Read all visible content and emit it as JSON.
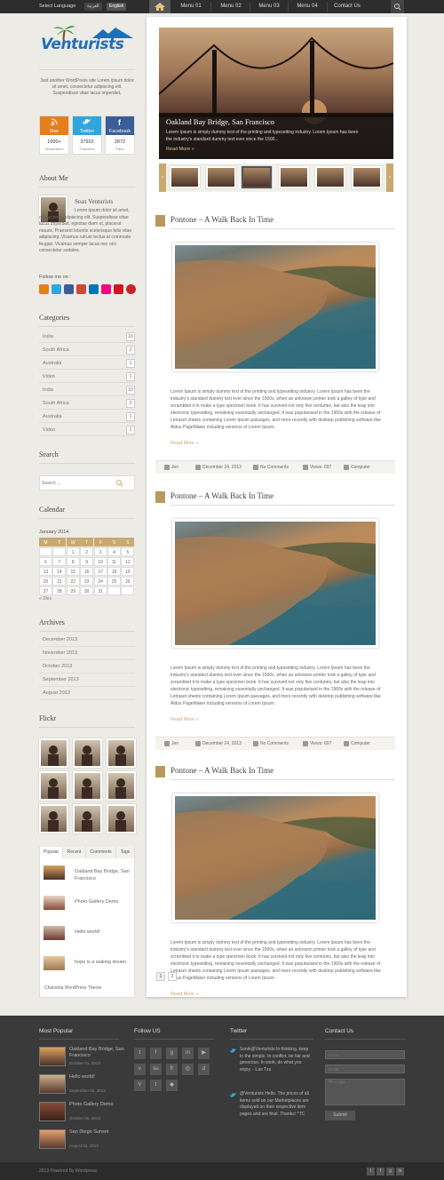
{
  "topbar": {
    "language_label": "Select Language",
    "languages": [
      "العربية",
      "English"
    ],
    "menu": [
      "Menu 01",
      "Menu 02",
      "Menu 03",
      "Menu 04",
      "Contact Us"
    ]
  },
  "logo": {
    "text": "Venturists"
  },
  "tagline": "Just another WordPress site Lorem ipsum dolor sit amet, consectetur adipiscing elit. Suspendisse vitae lacus imperdiet,",
  "social": [
    {
      "name": "Rss",
      "count": "1000+",
      "unit": "Subscribers",
      "color": "#e57e1c"
    },
    {
      "name": "Twitter",
      "count": "37922",
      "unit": "Followers",
      "color": "#2fa6dd"
    },
    {
      "name": "Facebook",
      "count": "2872",
      "unit": "Fans",
      "color": "#3b5d98"
    }
  ],
  "about": {
    "title": "About Me",
    "name": "Sean Venturists",
    "bio": "Lorem ipsum dolor sit amet, consectetur adipiscing elit. Suspendisse vitae lacus imperdiet, egestas diam ut, placerat mauris. Praesent lobortis scelerisque felis vitae adipiscing. Vivamus rutrum lectus at commodo feugiat. Vivamus semper lacus nec orci consectetur sodales.",
    "follow_label": "Follow me on :"
  },
  "categories": {
    "title": "Categories",
    "items": [
      {
        "name": "India",
        "count": "10"
      },
      {
        "name": "South Africa",
        "count": "2"
      },
      {
        "name": "Australia",
        "count": "1"
      },
      {
        "name": "Video",
        "count": "1"
      },
      {
        "name": "India",
        "count": "10"
      },
      {
        "name": "South Africa",
        "count": "2"
      },
      {
        "name": "Australia",
        "count": "1"
      },
      {
        "name": "Video",
        "count": "1"
      }
    ]
  },
  "search": {
    "title": "Search",
    "placeholder": "Search ..."
  },
  "calendar": {
    "title": "Calendar",
    "month": "January 2014",
    "days": [
      "M",
      "T",
      "W",
      "T",
      "F",
      "S",
      "S"
    ],
    "cells": [
      "",
      "",
      "1",
      "2",
      "3",
      "4",
      "5",
      "6",
      "7",
      "8",
      "9",
      "10",
      "11",
      "12",
      "13",
      "14",
      "15",
      "16",
      "17",
      "18",
      "19",
      "20",
      "21",
      "22",
      "23",
      "24",
      "25",
      "26",
      "27",
      "28",
      "29",
      "30",
      "31",
      "",
      ""
    ],
    "prev": "« Dec"
  },
  "archives": {
    "title": "Archives",
    "items": [
      "December 2013",
      "November 2013",
      "October 2013",
      "September 2013",
      "August 2013"
    ]
  },
  "flickr": {
    "title": "Flickr"
  },
  "tabs": {
    "labels": [
      "Popular",
      "Recent",
      "Comments",
      "Tags"
    ],
    "items": [
      "Oakland Bay Bridge, San Francisco",
      "Photo Gallery Demo",
      "Hello world!",
      "hope is a waking dream."
    ],
    "footer": "Charisma WordPress Theme"
  },
  "slider": {
    "title": "Oakland Bay Bridge, San Francisco",
    "text": "Lorem Ipsum is simply dummy text of the printing and typesetting industry. Lorem Ipsum has been the industry's standard dummy text ever since the 1500...",
    "more": "Read More »",
    "arrow_left": "‹",
    "arrow_right": "›"
  },
  "posts": [
    {
      "title": "Pontone – A Walk Back In Time",
      "text": "Lorem Ipsum is simply dummy text of the printing and typesetting industry. Lorem Ipsum has been the industry's standard dummy text ever since the 1500s, when an unknown printer took a galley of type and scrambled it to make a type specimen book. It has survived not only five centuries, but also the leap into electronic typesetting, remaining essentially unchanged. It was popularised in the 1960s with the release of Letraset sheets containing Lorem Ipsum passages, and more recently with desktop publishing software like Aldus PageMaker including versions of Lorem Ipsum.",
      "more": "Read More »",
      "author": "Jen",
      "date": "December 24, 2013",
      "comments": "No Comments",
      "views": "Views: 697",
      "category": "Computer"
    },
    {
      "title": "Pontone – A Walk Back In Time",
      "text": "Lorem Ipsum is simply dummy text of the printing and typesetting industry. Lorem Ipsum has been the industry's standard dummy text ever since the 1500s, when an unknown printer took a galley of type and scrambled it to make a type specimen book. It has survived not only five centuries, but also the leap into electronic typesetting, remaining essentially unchanged. It was popularised in the 1960s with the release of Letraset sheets containing Lorem Ipsum passages, and more recently with desktop publishing software like Aldus PageMaker including versions of Lorem Ipsum.",
      "more": "Read More »",
      "author": "Jen",
      "date": "December 24, 2013",
      "comments": "No Comments",
      "views": "Views: 697",
      "category": "Computer"
    },
    {
      "title": "Pontone – A Walk Back In Time",
      "text": "Lorem Ipsum is simply dummy text of the printing and typesetting industry. Lorem Ipsum has been the industry's standard dummy text ever since the 1500s, when an unknown printer took a galley of type and scrambled it to make a type specimen book. It has survived not only five centuries, but also the leap into electronic typesetting, remaining essentially unchanged. It was popularised in the 1960s with the release of Letraset sheets containing Lorem Ipsum passages, and more recently with desktop publishing software like Aldus PageMaker including versions of Lorem Ipsum.",
      "more": "Read More »"
    }
  ],
  "pagination": [
    "1",
    "2"
  ],
  "footer": {
    "popular_title": "Most Popular",
    "popular": [
      {
        "t": "Oakland Bay Bridge, San Francisco",
        "d": "October 01, 2013"
      },
      {
        "t": "Hello world!",
        "d": "September 02, 2013"
      },
      {
        "t": "Photo Gallery Demo",
        "d": "October 06, 2013"
      },
      {
        "t": "San Diego Sunset",
        "d": "August 02, 2013"
      }
    ],
    "follow_title": "Follow US",
    "twitter_title": "Twitter",
    "tweets": [
      "Sonik@Venturists In thinking, keep to the simple. In conflict, be fair and generous. In work, do what you enjoy. - Lao Tzu",
      "@Venturists Hello. The prices of all items sold on our Marketplaces are displayed on their respective item pages and are final. Thanks! ^TC"
    ],
    "contact_title": "Contact Us",
    "name_ph": "Name",
    "email_ph": "Email",
    "message_ph": "Message",
    "submit": "Submit"
  },
  "copyright": "2013 Powered By Wordpress."
}
